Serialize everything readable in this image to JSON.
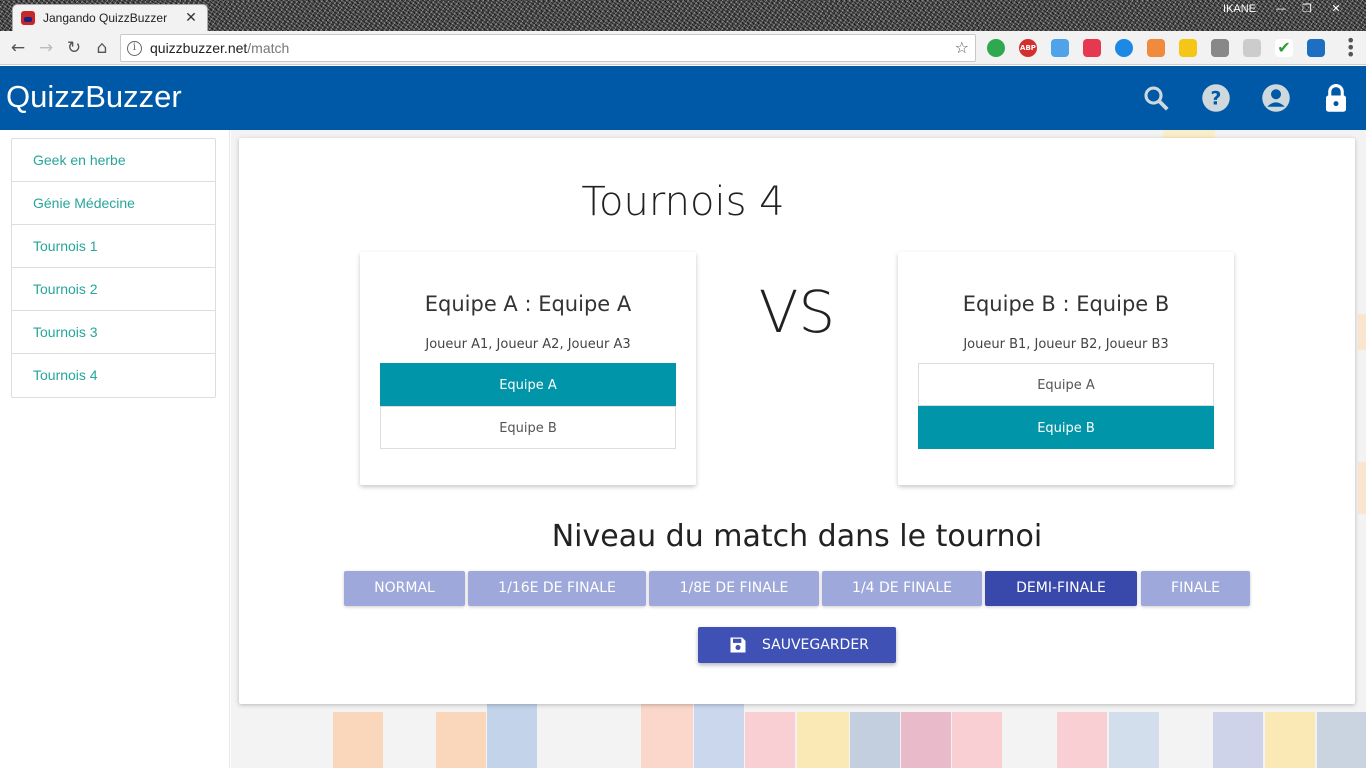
{
  "browser": {
    "tab_title": "Jangando QuizzBuzzer",
    "tab_close": "✕",
    "window_user": "IKANE",
    "url_host": "quizzbuzzer.net",
    "url_path": "/match",
    "extensions": [
      "evernote-icon",
      "adblock-icon",
      "cloud-icon",
      "screencast-icon",
      "eye-icon",
      "gitlab-icon",
      "notes-icon",
      "eyedropper-icon",
      "chat-icon",
      "check-icon",
      "s-icon"
    ]
  },
  "app": {
    "brand": "QuizzBuzzer",
    "header_icons": [
      "search-icon",
      "help-icon",
      "account-icon",
      "lock-icon"
    ],
    "header_color": "#0059a7"
  },
  "sidebar": {
    "items": [
      {
        "label": "Geek en herbe"
      },
      {
        "label": "Génie Médecine"
      },
      {
        "label": "Tournois 1"
      },
      {
        "label": "Tournois 2"
      },
      {
        "label": "Tournois 3"
      },
      {
        "label": "Tournois 4"
      }
    ]
  },
  "match": {
    "title": "Tournois 4",
    "vs": "VS",
    "team_a": {
      "name": "Equipe A : Equipe A",
      "players": "Joueur A1, Joueur A2, Joueur A3",
      "options": [
        {
          "label": "Equipe A",
          "selected": true
        },
        {
          "label": "Equipe B",
          "selected": false
        }
      ]
    },
    "team_b": {
      "name": "Equipe B : Equipe B",
      "players": "Joueur B1, Joueur B2, Joueur B3",
      "options": [
        {
          "label": "Equipe A",
          "selected": false
        },
        {
          "label": "Equipe B",
          "selected": true
        }
      ]
    },
    "niveau_title": "Niveau du match dans le tournoi",
    "levels": [
      {
        "label": "Normal",
        "selected": false
      },
      {
        "label": "1/16e de finale",
        "selected": false
      },
      {
        "label": "1/8e de finale",
        "selected": false
      },
      {
        "label": "1/4 de finale",
        "selected": false
      },
      {
        "label": "Demi-finale",
        "selected": true
      },
      {
        "label": "Finale",
        "selected": false
      }
    ],
    "save_label": "SAUVEGARDER",
    "selected_color": "#0095a8",
    "level_selected_color": "#3949ab",
    "level_color": "#9fa8da"
  }
}
